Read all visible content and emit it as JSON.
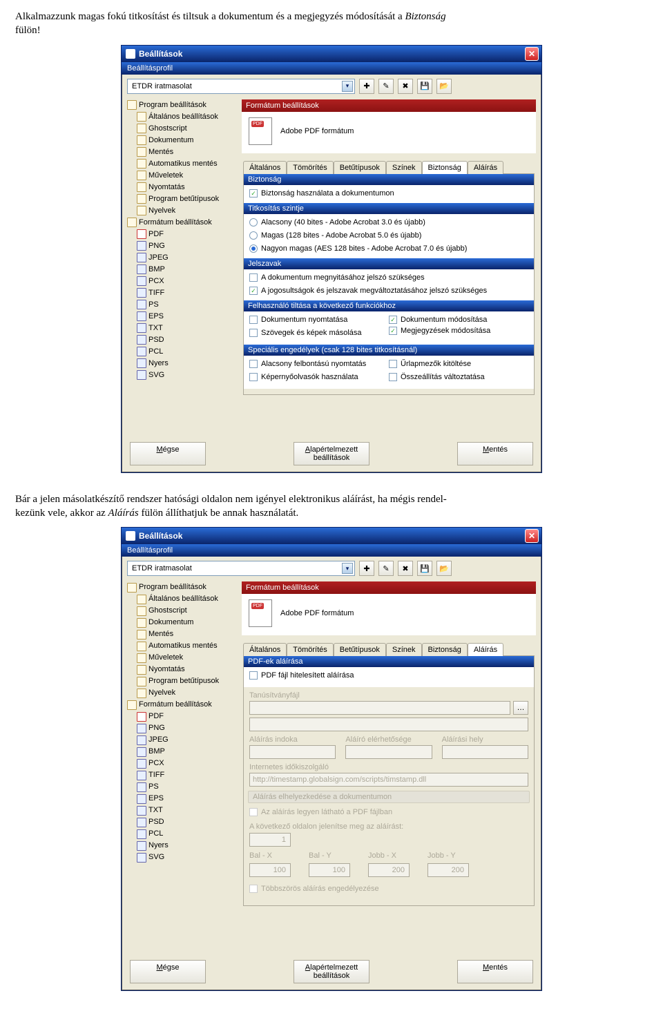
{
  "intro": {
    "line1a": "Alkalmazzunk magas fokú titkosítást és tiltsuk a dokumentum és a megjegyzés módosítását a ",
    "line1b": "Biztonság",
    "line2": "fülön!"
  },
  "between": {
    "p1a": "Bár a jelen másolatkészítő rendszer hatósági oldalon nem igényel elektronikus aláírást, ha mégis rendel-",
    "p1b": "kezünk vele, akkor az ",
    "p1c": "Aláírás",
    "p1d": " fülön állíthatjuk be annak használatát."
  },
  "dialog": {
    "title": "Beállítások",
    "section_profile": "Beállításprofil",
    "profile_value": "ETDR iratmasolat",
    "tree": {
      "root1": "Program beállítások",
      "c1": "Általános beállítások",
      "c2": "Ghostscript",
      "c3": "Dokumentum",
      "c4": "Mentés",
      "c5": "Automatikus mentés",
      "c6": "Műveletek",
      "c7": "Nyomtatás",
      "c8": "Program betűtípusok",
      "c9": "Nyelvek",
      "root2": "Formátum beállítások",
      "f_pdf": "PDF",
      "f_png": "PNG",
      "f_jpeg": "JPEG",
      "f_bmp": "BMP",
      "f_pcx": "PCX",
      "f_tiff": "TIFF",
      "f_ps": "PS",
      "f_eps": "EPS",
      "f_txt": "TXT",
      "f_psd": "PSD",
      "f_pcl": "PCL",
      "f_ny": "Nyers",
      "f_svg": "SVG"
    },
    "group_format": "Formátum beállítások",
    "format_label": "Adobe PDF formátum",
    "tabs": {
      "altalanos": "Általános",
      "tomorites": "Tömörítés",
      "betutipusok": "Betűtípusok",
      "szinek": "Színek",
      "biztonsag": "Biztonság",
      "alairas": "Aláírás"
    },
    "sec_main_hdr": "Biztonság",
    "sec_use": "Biztonság használata a dokumentumon",
    "sec_level_hdr": "Titkosítás szintje",
    "lvl_low": "Alacsony (40 bites - Adobe Acrobat 3.0 és újabb)",
    "lvl_high": "Magas (128 bites - Adobe Acrobat 5.0 és újabb)",
    "lvl_vhigh": "Nagyon magas (AES 128 bites - Adobe Acrobat 7.0 és újabb)",
    "sec_pw_hdr": "Jelszavak",
    "pw_open": "A dokumentum megnyitásához jelszó szükséges",
    "pw_perm": "A jogosultságok és jelszavak megváltoztatásához jelszó szükséges",
    "sec_block_hdr": "Felhasználó tiltása a következő funkciókhoz",
    "blk_print": "Dokumentum nyomtatása",
    "blk_modify": "Dokumentum módosítása",
    "blk_copy": "Szövegek és képek másolása",
    "blk_comm": "Megjegyzések módosítása",
    "sec_spec_hdr": "Speciális engedélyek (csak 128 bites titkosításnál)",
    "sp_lowres": "Alacsony felbontású nyomtatás",
    "sp_form": "Űrlapmezők kitöltése",
    "sp_screen": "Képernyőolvasók használata",
    "sp_assemble": "Összeállítás változtatása",
    "btn_cancel": "Mégse",
    "btn_default": "Alapértelmezett\nbeállítások",
    "btn_default1": "Alapértelmezett",
    "btn_default2": "beállítások",
    "btn_save": "Mentés"
  },
  "dialog2": {
    "sign_hdr": "PDF-ek aláírása",
    "sign_use": "PDF fájl hitelesített aláírása",
    "cert_label": "Tanúsítványfájl",
    "reason_label": "Aláírás indoka",
    "contact_label": "Aláíró elérhetősége",
    "location_label": "Aláírási hely",
    "timeserver_label": "Internetes időkiszolgáló",
    "timeserver_value": "http://timestamp.globalsign.com/scripts/timstamp.dll",
    "place_hdr": "Aláírás elhelyezkedése a dokumentumon",
    "visible": "Az aláírás legyen látható a PDF fájlban",
    "showpage": "A következő oldalon jelenítse meg az aláírást:",
    "page_val": "1",
    "balx": "Bal - X",
    "baly": "Bal - Y",
    "jobbx": "Jobb - X",
    "jobby": "Jobb - Y",
    "vx1": "100",
    "vy1": "100",
    "vx2": "200",
    "vy2": "200",
    "multi": "Többszörös aláírás engedélyezése"
  }
}
